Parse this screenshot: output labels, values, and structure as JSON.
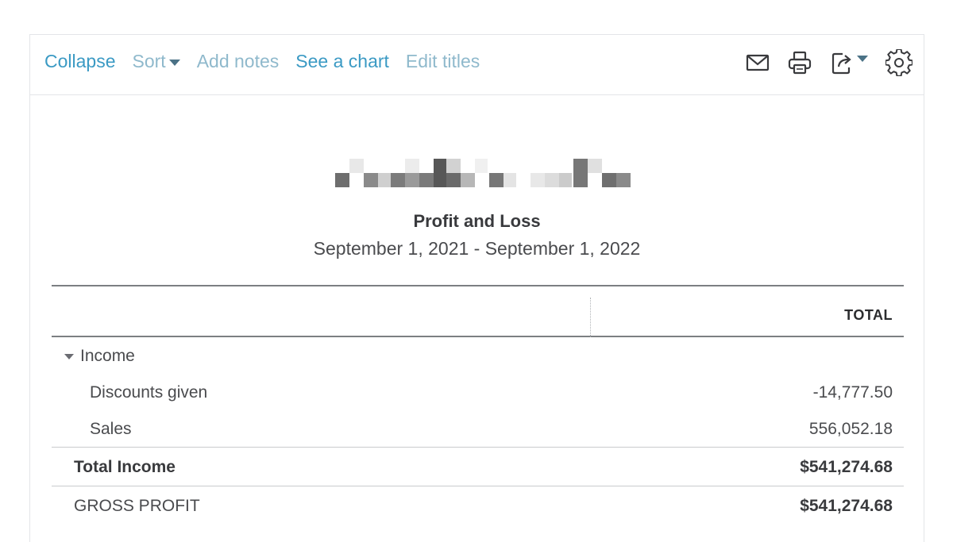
{
  "toolbar": {
    "links": {
      "collapse": "Collapse",
      "sort": "Sort",
      "add_notes": "Add notes",
      "see_chart": "See a chart",
      "edit_titles": "Edit titles"
    },
    "icons": [
      "mail-icon",
      "print-icon",
      "export-icon",
      "chevron-down-icon",
      "gear-icon"
    ]
  },
  "report": {
    "title": "Profit and Loss",
    "period": "September 1, 2021 - September 1, 2022",
    "column_header": "TOTAL",
    "income_section": "Income",
    "rows": [
      {
        "label": "Discounts given",
        "value": "-14,777.50"
      },
      {
        "label": "Sales",
        "value": "556,052.18"
      }
    ],
    "total_income": {
      "label": "Total Income",
      "value": "$541,274.68"
    },
    "gross_profit": {
      "label": "GROSS PROFIT",
      "value": "$541,274.68"
    }
  },
  "colors": {
    "link_active": "#3b9ac4",
    "link_muted": "#8fb9cc",
    "text": "#393a3d",
    "rule": "#7c7f82"
  }
}
